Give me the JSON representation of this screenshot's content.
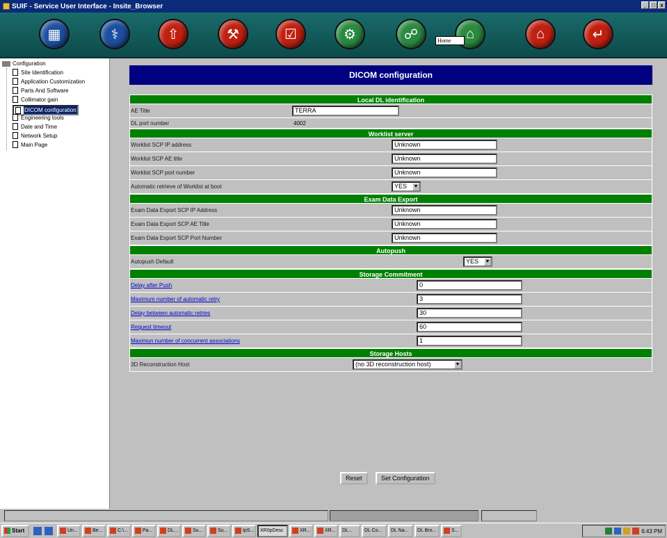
{
  "window": {
    "title": "SUIF - Service User Interface - Insite_Browser",
    "controls": [
      "_",
      "□",
      "x"
    ]
  },
  "toolbar": {
    "buttons": [
      {
        "name": "calendar-icon",
        "color": "#1c4fa0",
        "glyph": "▦"
      },
      {
        "name": "stethoscope-icon",
        "color": "#1c4fa0",
        "glyph": "⚕"
      },
      {
        "name": "export-icon",
        "color": "#c02010",
        "glyph": "⇧"
      },
      {
        "name": "hammer-icon",
        "color": "#c02010",
        "glyph": "⚒"
      },
      {
        "name": "config-list-icon",
        "color": "#c02010",
        "glyph": "☑"
      },
      {
        "name": "tools-icon",
        "color": "#2a8a40",
        "glyph": "⚙"
      },
      {
        "name": "network-icon",
        "color": "#2a8a40",
        "glyph": "☍"
      },
      {
        "name": "home-tools-icon",
        "color": "#2a8a40",
        "glyph": "⌂"
      },
      {
        "name": "building-icon",
        "color": "#c02010",
        "glyph": "⌂"
      },
      {
        "name": "exit-door-icon",
        "color": "#c02010",
        "glyph": "↵"
      }
    ],
    "tooltip": "Home"
  },
  "tree": {
    "root": "Configuration",
    "items": [
      {
        "label": "Site Identification",
        "selected": false
      },
      {
        "label": "Application Customization",
        "selected": false
      },
      {
        "label": "Parts And Software",
        "selected": false
      },
      {
        "label": "Collimator gain",
        "selected": false
      },
      {
        "label": "DICOM configuration",
        "selected": true
      },
      {
        "label": "Engineering tools",
        "selected": false
      },
      {
        "label": "Date and Time",
        "selected": false
      },
      {
        "label": "Network Setup",
        "selected": false
      },
      {
        "label": "Main Page",
        "selected": false
      }
    ]
  },
  "page": {
    "title": "DICOM configuration"
  },
  "local": {
    "header": "Local DL identification",
    "ae_title_label": "AE Title",
    "ae_title_value": "TERRA",
    "port_label": "DL port number",
    "port_value": "4002"
  },
  "worklist": {
    "header": "Worklist server",
    "ip_label": "Worklist SCP IP address",
    "ip_value": "Unknown",
    "ae_label": "Worklist SCP AE title",
    "ae_value": "Unknown",
    "port_label": "Worklist SCP port number",
    "port_value": "Unknown",
    "auto_label": "Automatic retrieve of Worklist at boot",
    "auto_value": "YES"
  },
  "export": {
    "header": "Exam Data Export",
    "ip_label": "Exam Data Export SCP IP Address",
    "ip_value": "Unknown",
    "ae_label": "Exam Data Export SCP AE Title",
    "ae_value": "Unknown",
    "port_label": "Exam Data Export SCP Port Number",
    "port_value": "Unknown"
  },
  "autopush": {
    "header": "Autopush",
    "label": "Autopush Default",
    "value": "YES"
  },
  "storage": {
    "header": "Storage Commitment",
    "delay_label": "Delay after Push",
    "delay_value": "0",
    "retry_label": "Maximum number of automatic retry",
    "retry_value": "3",
    "between_label": "Delay between automatic retries",
    "between_value": "30",
    "timeout_label": "Request timeout",
    "timeout_value": "60",
    "assoc_label": "Maximun number of concurrent associations",
    "assoc_value": "1"
  },
  "hosts": {
    "header": "Storage Hosts",
    "label": "3D Reconstruction Host",
    "value": "(no 3D reconstruction host)"
  },
  "actions": {
    "reset": "Reset",
    "set": "Set Configuration"
  },
  "taskbar": {
    "start": "Start",
    "tasks": [
      "Un...",
      "Be...",
      "C:\\...",
      "Pa...",
      "DL...",
      "Su...",
      "Su...",
      "IpS...",
      "XR0pDesc",
      "XR...",
      "XR...",
      "DL...",
      "DL Co...",
      "DL Na...",
      "DL Bro...",
      "S..."
    ],
    "clock": "6:43 PM"
  }
}
